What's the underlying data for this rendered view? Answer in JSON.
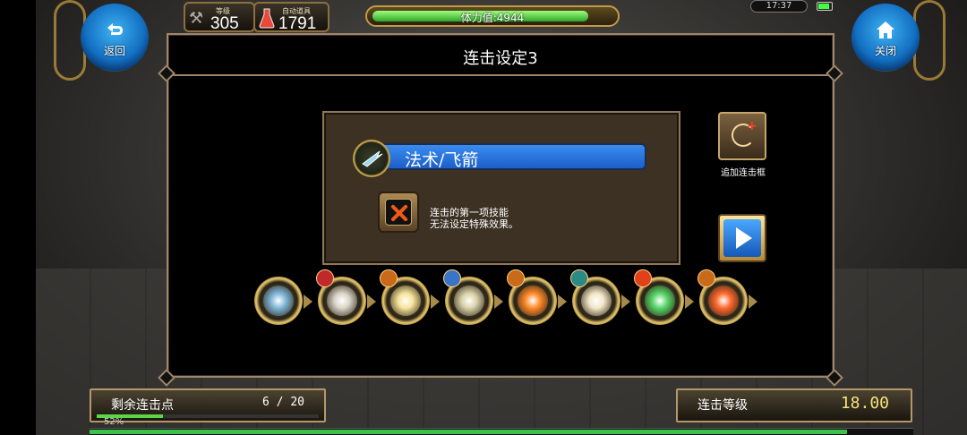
{
  "hud": {
    "level_label": "等级",
    "level_value": "305",
    "potion_label": "自动道具",
    "potion_value": "1791",
    "stamina_text": "体力值:4944",
    "stamina_fraction": 0.9,
    "clock": "17:37"
  },
  "nav": {
    "back_label": "返回",
    "close_label": "关闭"
  },
  "panel": {
    "title": "连击设定3",
    "skill_name": "法术/飞箭",
    "note_line1": "连击的第一项技能",
    "note_line2": "无法设定特殊效果。",
    "add_frame_label": "追加连击框"
  },
  "skills": [
    {
      "name": "flying-arrow",
      "color": "#7fb7d8",
      "badge": ""
    },
    {
      "name": "wind-slash",
      "color": "#d8d4c8",
      "badge": "red"
    },
    {
      "name": "light-burst",
      "color": "#f6e49a",
      "badge": "orange"
    },
    {
      "name": "light-beam",
      "color": "#d9d2a8",
      "badge": "blue"
    },
    {
      "name": "fire-burst",
      "color": "#ff8a2a",
      "badge": "orange"
    },
    {
      "name": "holy-barrier",
      "color": "#f1e6c6",
      "badge": "teal"
    },
    {
      "name": "green-aura",
      "color": "#58d66a",
      "badge": "fire"
    },
    {
      "name": "dome-shield",
      "color": "#ff6a30",
      "badge": "orange"
    }
  ],
  "bottom": {
    "combo_points_label": "剩余连击点",
    "combo_points_value": "6 / 20",
    "combo_points_fraction": 0.3,
    "combo_level_label": "连击等级",
    "combo_level_value": "18.00",
    "exp_text": "52%",
    "exp_fraction": 0.92
  }
}
